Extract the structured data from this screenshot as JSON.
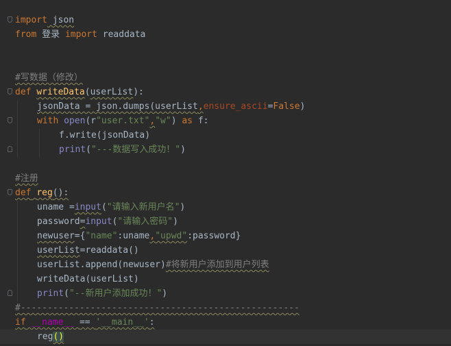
{
  "editor": {
    "colors": {
      "background": "#2b2b2b",
      "current_line": "#323232",
      "keyword": "#cc7832",
      "function": "#ffc66d",
      "string": "#6a8759",
      "comment": "#808080",
      "kwarg": "#aa4926",
      "builtin": "#8888c6",
      "default": "#a9b7c6"
    },
    "icons": [
      "fold-marker-icon"
    ],
    "lines": {
      "l1": {
        "kw1": "import",
        "mod": " json"
      },
      "l2": {
        "kw1": "from",
        "mod": " 登录 ",
        "kw2": "import",
        "name": " readdata"
      },
      "l5": {
        "comment": "#写数据（修改）"
      },
      "l6": {
        "kw": "def",
        "fn": "writeData",
        "open": "(",
        "param": "userList",
        "close": "):"
      },
      "l7": {
        "a": "jsonData = json.dumps(userList",
        "comma": ",",
        "kwarg": "ensure_ascii",
        "eq": "=",
        "val": "False",
        "close": ")"
      },
      "l8": {
        "kw": "with",
        "bi": "open",
        "p1": "(r",
        "s1": "\"user.txt\"",
        "comma": ",",
        "s2": "\"w\"",
        "p2": ") ",
        "as": "as",
        "rest": " f:"
      },
      "l9": {
        "code": "f.write(jsonData)"
      },
      "l10": {
        "bi": "print",
        "p1": "(",
        "s": "\"---数据写入成功！\"",
        "p2": ")"
      },
      "l12": {
        "comment": "#注册"
      },
      "l13": {
        "kw": "def",
        "fn": "reg",
        "rest": "():"
      },
      "l14": {
        "a": "uname =",
        "bi": "input",
        "p1": "(",
        "s": "\"请输入新用户名\"",
        "p2": ")"
      },
      "l15": {
        "a": "password",
        "eq": "=",
        "bi": "input",
        "p1": "(",
        "s": "\"请输入密码\"",
        "p2": ")"
      },
      "l16": {
        "var": "newuser",
        "eq": "=",
        "b1": "{",
        "s1": "\"name\"",
        "c1": ":",
        "v1": "uname",
        "comma": ",",
        "s2": "\"upwd\"",
        "c2": ":",
        "v2": "password",
        "b2": "}"
      },
      "l17": {
        "var": "userList",
        "eq": "=",
        "rest": "readdata()"
      },
      "l18": {
        "code": "userList.append(newuser)",
        "comment": "#将新用户添加到用户列表"
      },
      "l19": {
        "code": "writeData(userList)"
      },
      "l20": {
        "bi": "print",
        "p1": "(",
        "s": "\"--新用户添加成功！\"",
        "p2": ")"
      },
      "l21": {
        "comment": "#----------------------------------------------------"
      },
      "l22": {
        "kw": "if",
        "name": " __name__ ",
        "op": "== ",
        "s": "'__main__'",
        "colon": ":"
      },
      "l23": {
        "call": "reg",
        "parens": "()"
      }
    }
  }
}
